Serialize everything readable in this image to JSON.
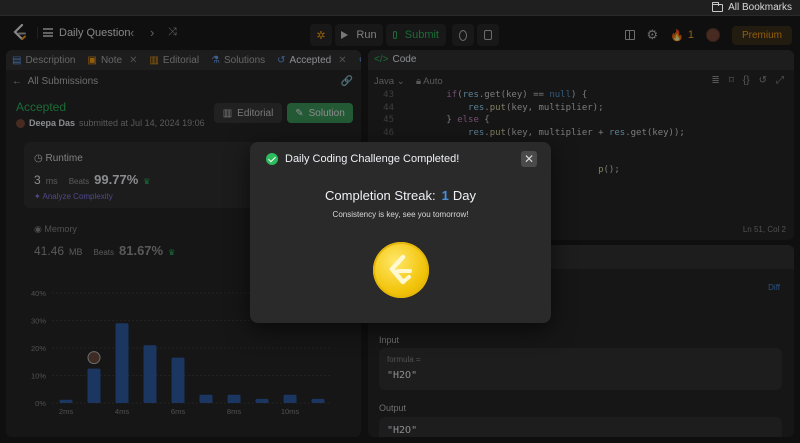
{
  "bookmarks": {
    "label": "All Bookmarks"
  },
  "topnav": {
    "problem_list_label": "Daily Question",
    "run_label": "Run",
    "submit_label": "Submit",
    "streak_count": "1",
    "premium_label": "Premium"
  },
  "left_tabs": [
    {
      "label": "Description"
    },
    {
      "label": "Note"
    },
    {
      "label": "Editorial"
    },
    {
      "label": "Solutions"
    },
    {
      "label": "Accepted"
    },
    {
      "label": "Su"
    }
  ],
  "submission": {
    "back_label": "All Submissions",
    "status": "Accepted",
    "user": "Deepa Das",
    "submitted_text": "submitted at Jul 14, 2024 19:06",
    "editorial_button": "Editorial",
    "solution_button": "Solution"
  },
  "runtime": {
    "label": "Runtime",
    "value": "3",
    "unit": "ms",
    "beats_label": "Beats",
    "beats_pct": "99.77%",
    "analyze_label": "Analyze Complexity"
  },
  "memory": {
    "label": "Memory",
    "value": "41.46",
    "unit": "MB",
    "beats_label": "Beats",
    "beats_pct": "81.67%"
  },
  "chart_data": {
    "type": "bar",
    "y_ticks": [
      "40%",
      "30%",
      "20%",
      "10%",
      "0%"
    ],
    "ylim": [
      0,
      40
    ],
    "x_labels": [
      "2ms",
      "4ms",
      "6ms",
      "8ms",
      "10ms"
    ],
    "values": [
      1.2,
      12.5,
      29,
      21,
      16.5,
      3,
      3,
      1.5,
      3,
      1.5
    ],
    "highlight_index": 1,
    "bar_color": "#2f5fa8"
  },
  "editor": {
    "title": "Code",
    "language": "Java",
    "mode": "Auto",
    "lines": [
      {
        "n": "43",
        "indent": "        ",
        "tokens": [
          [
            "kw",
            "if"
          ],
          [
            "",
            "("
          ],
          [
            "vr",
            "res"
          ],
          [
            "",
            ".get(key) == "
          ],
          [
            "lit",
            "null"
          ],
          [
            "",
            ") {"
          ]
        ]
      },
      {
        "n": "44",
        "indent": "            ",
        "tokens": [
          [
            "vr",
            "res"
          ],
          [
            "",
            "."
          ],
          [
            "fn",
            "put"
          ],
          [
            "",
            "(key, multiplier);"
          ]
        ]
      },
      {
        "n": "45",
        "indent": "        ",
        "tokens": [
          [
            "",
            "} "
          ],
          [
            "kw",
            "else"
          ],
          [
            "",
            " {"
          ]
        ]
      },
      {
        "n": "46",
        "indent": "            ",
        "tokens": [
          [
            "vr",
            "res"
          ],
          [
            "",
            "."
          ],
          [
            "fn",
            "put"
          ],
          [
            "",
            "(key, multiplier + "
          ],
          [
            "vr",
            "res"
          ],
          [
            "",
            ".get(key));"
          ]
        ]
      },
      {
        "n": "",
        "indent": "",
        "tokens": []
      },
      {
        "n": "",
        "indent": "",
        "tokens": []
      },
      {
        "n": "",
        "indent": "                                    ",
        "tokens": [
          [
            "fn",
            "p"
          ],
          [
            "",
            "();"
          ]
        ]
      }
    ],
    "cursor_pos": "Ln 51, Col 2"
  },
  "testcase": {
    "diff_label": "Diff",
    "input_label": "Input",
    "input_param": "formula =",
    "input_value": "\"H2O\"",
    "output_label": "Output",
    "output_value": "\"H2O\""
  },
  "modal": {
    "title": "Daily Coding Challenge Completed!",
    "close": "✕",
    "streak_label": "Completion Streak:",
    "streak_value": "1",
    "streak_unit": "Day",
    "message": "Consistency is key, see you tomorrow!"
  },
  "colors": {
    "accent_green": "#2cbb5d",
    "accent_orange": "#ffa116",
    "accent_blue": "#4a90e2",
    "coin_gold": "#f2c40b"
  }
}
